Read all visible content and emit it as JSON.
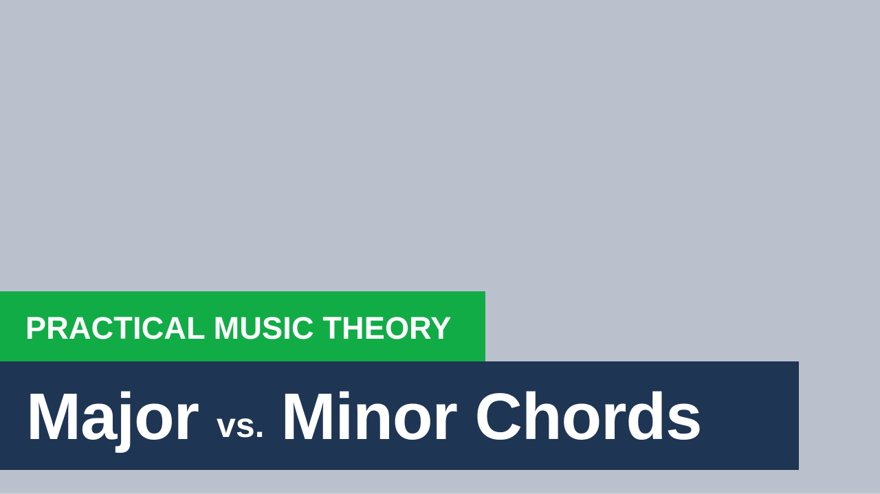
{
  "series": {
    "label": "PRACTICAL MUSIC THEORY"
  },
  "title": {
    "first": "Major",
    "connector": "vs.",
    "second": "Minor Chords"
  },
  "colors": {
    "background": "#bbc1cc",
    "series_banner": "#12ac47",
    "title_banner": "#1f3554",
    "text": "#ffffff"
  }
}
